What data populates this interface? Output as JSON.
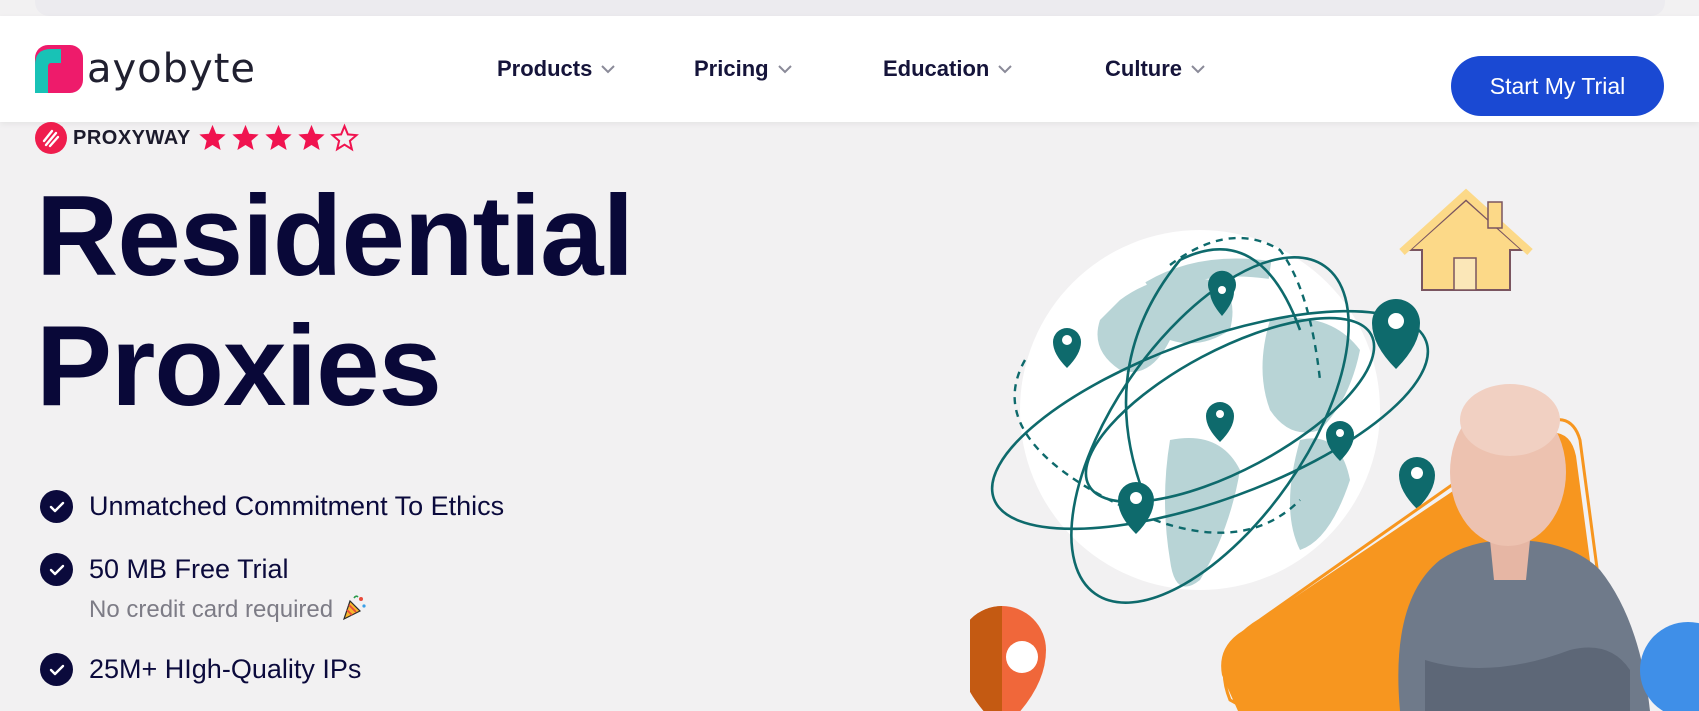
{
  "brand": {
    "name": "ayobyte"
  },
  "nav": {
    "items": [
      {
        "label": "Products"
      },
      {
        "label": "Pricing"
      },
      {
        "label": "Education"
      },
      {
        "label": "Culture"
      }
    ],
    "cta_label": "Start My Trial"
  },
  "rating": {
    "provider": "PROXYWAY",
    "stars": 4,
    "max": 5
  },
  "hero": {
    "title_line1": "Residential",
    "title_line2": "Proxies"
  },
  "features": [
    {
      "text": "Unmatched Commitment To Ethics"
    },
    {
      "text": "50 MB Free Trial",
      "sub": "No credit card required",
      "sub_icon": "party-popper-icon"
    },
    {
      "text": "25M+ HIgh-Quality IPs"
    }
  ],
  "colors": {
    "accent": "#1a49d3",
    "heading": "#090838",
    "star": "#f0134f",
    "pin": "#0e6a6c",
    "orange": "#f7961f"
  }
}
